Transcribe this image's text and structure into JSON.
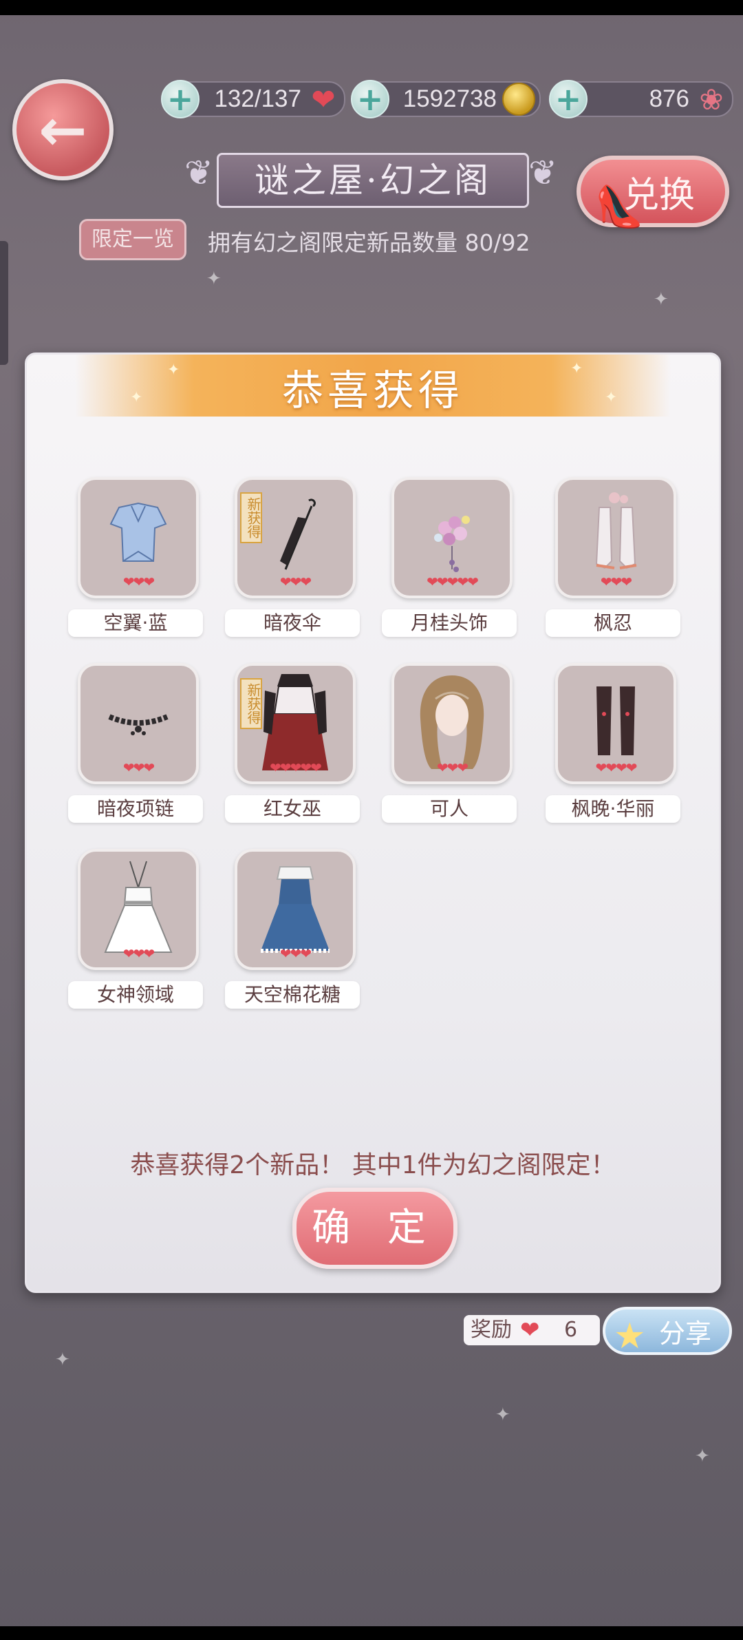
{
  "hud": {
    "hearts": "132/137",
    "coins": "1592738",
    "diamonds": "876"
  },
  "header": {
    "title": "谜之屋·幻之阁",
    "exchange_label": "兑换",
    "limited_label": "限定一览",
    "owned_text": "拥有幻之阁限定新品数量 80/92"
  },
  "modal": {
    "title": "恭喜获得",
    "items": [
      {
        "name": "空翼·蓝",
        "hearts": "❤❤❤",
        "new": ""
      },
      {
        "name": "暗夜伞",
        "hearts": "❤❤❤",
        "new": "新获得"
      },
      {
        "name": "月桂头饰",
        "hearts": "❤❤❤❤❤",
        "new": ""
      },
      {
        "name": "枫忍",
        "hearts": "❤❤❤",
        "new": ""
      },
      {
        "name": "暗夜项链",
        "hearts": "❤❤❤",
        "new": ""
      },
      {
        "name": "红女巫",
        "hearts": "❤❤❤❤❤",
        "new": "新获得"
      },
      {
        "name": "可人",
        "hearts": "❤❤❤",
        "new": ""
      },
      {
        "name": "枫晚·华丽",
        "hearts": "❤❤❤❤",
        "new": ""
      },
      {
        "name": "女神领域",
        "hearts": "❤❤❤",
        "new": ""
      },
      {
        "name": "天空棉花糖",
        "hearts": "❤❤❤",
        "new": ""
      }
    ],
    "congrats_text": "恭喜获得2个新品！ 其中1件为幻之阁限定！",
    "confirm_label": "确 定"
  },
  "reward": {
    "label": "奖励",
    "count": "6",
    "share_label": "分享"
  },
  "colors": {
    "accent_red": "#e24a57",
    "button_pink": "#e06c74",
    "ribbon_orange": "#f2a64a",
    "tile_bg": "#c9bbbb"
  }
}
